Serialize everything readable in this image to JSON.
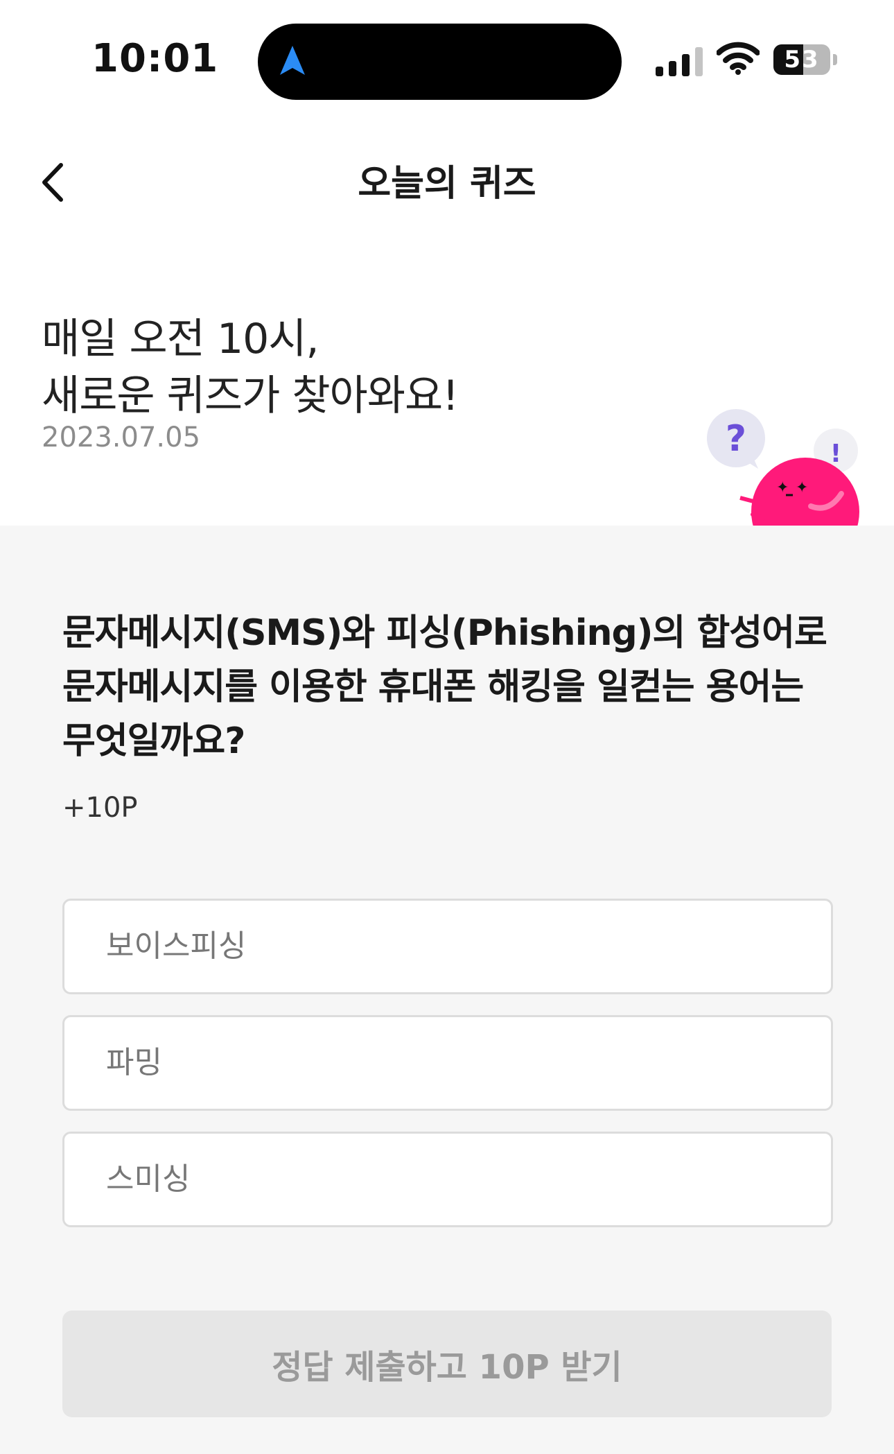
{
  "status_bar": {
    "time": "10:01",
    "battery_level": "53",
    "battery_fraction": 0.53,
    "signal_bars_active": 3,
    "signal_bars_total": 4
  },
  "header": {
    "title": "오늘의 퀴즈"
  },
  "hero": {
    "line1": "매일 오전 10시,",
    "line2": "새로운 퀴즈가 찾아와요!",
    "date": "2023.07.05",
    "mascot_bubble_question": "?",
    "mascot_bubble_exclaim": "!"
  },
  "quiz": {
    "question": "문자메시지(SMS)와 피싱(Phishing)의 합성어로 문자메시지를 이용한 휴대폰 해킹을 일컫는 용어는 무엇일까요?",
    "reward": "+10P",
    "options": [
      {
        "label": "보이스피싱"
      },
      {
        "label": "파밍"
      },
      {
        "label": "스미싱"
      }
    ],
    "submit_label": "정답 제출하고 10P 받기"
  },
  "colors": {
    "accent_pink": "#ff1a7a",
    "nav_arrow_blue": "#2b8cf5",
    "panel_bg": "#f6f6f6",
    "button_disabled_bg": "#e6e6e6",
    "bubble_purple": "#6b4fd8"
  },
  "icons": {
    "back": "chevron-left-icon",
    "navigation": "location-arrow-icon",
    "signal": "cellular-signal-icon",
    "wifi": "wifi-icon",
    "battery": "battery-icon",
    "mascot": "quiz-mascot-illustration"
  }
}
